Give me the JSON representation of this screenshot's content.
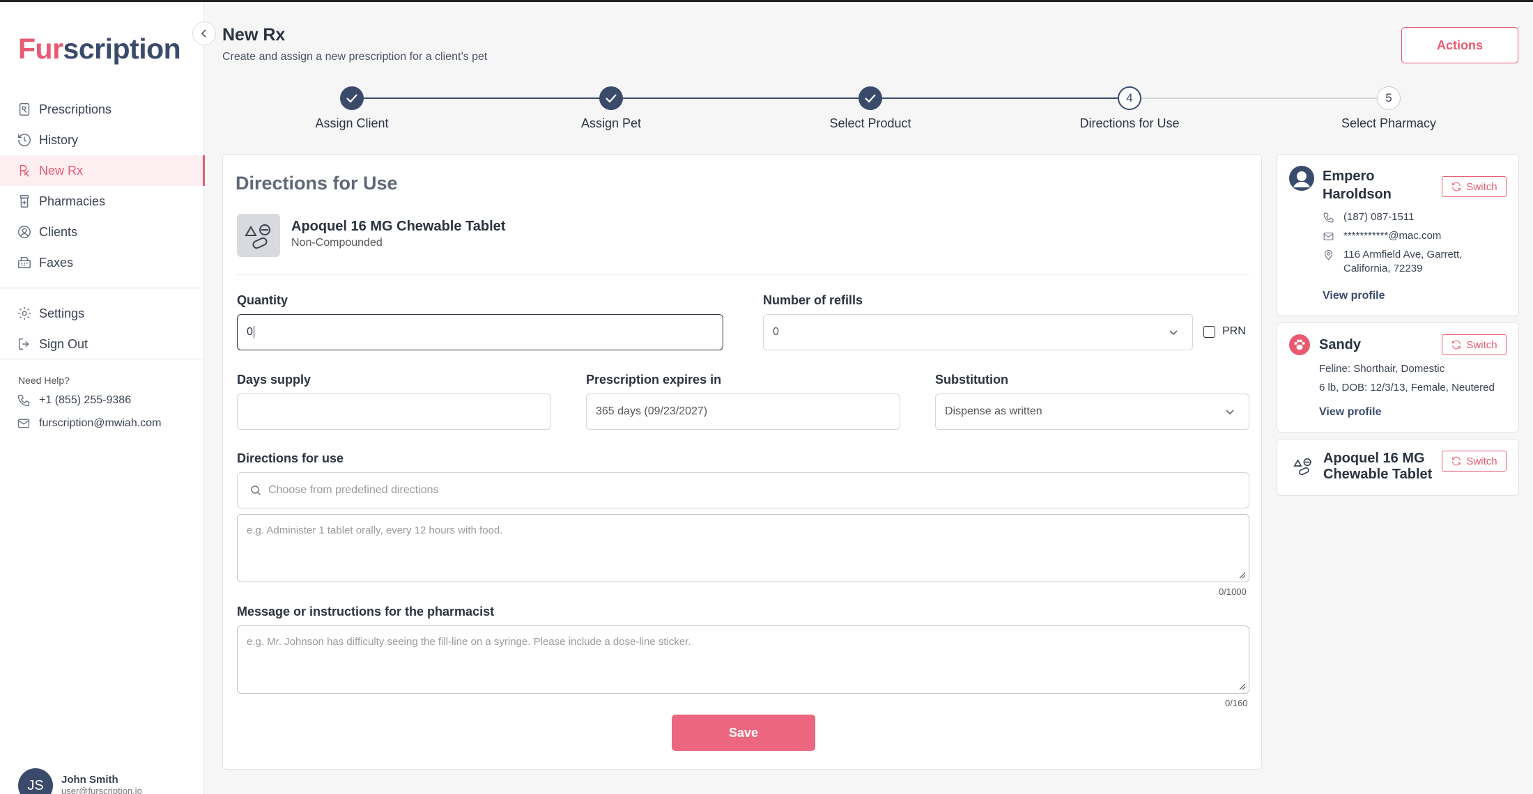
{
  "brand": {
    "part1": "Fur",
    "part2": "scription"
  },
  "sidebar": {
    "items": [
      {
        "label": "Prescriptions",
        "icon": "prescription-icon"
      },
      {
        "label": "History",
        "icon": "history-icon"
      },
      {
        "label": "New Rx",
        "icon": "rx-icon"
      },
      {
        "label": "Pharmacies",
        "icon": "pharmacy-icon"
      },
      {
        "label": "Clients",
        "icon": "client-icon"
      },
      {
        "label": "Faxes",
        "icon": "fax-icon"
      }
    ],
    "settings": "Settings",
    "signout": "Sign Out",
    "help_title": "Need Help?",
    "phone": "+1 (855) 255-9386",
    "email": "furscription@mwiah.com",
    "user": {
      "initials": "JS",
      "name": "John Smith",
      "email": "user@furscription.io"
    }
  },
  "header": {
    "title": "New Rx",
    "subtitle": "Create and assign a new prescription for a client’s pet",
    "actions_label": "Actions"
  },
  "stepper": {
    "steps": [
      {
        "label": "Assign Client",
        "state": "done"
      },
      {
        "label": "Assign Pet",
        "state": "done"
      },
      {
        "label": "Select Product",
        "state": "done"
      },
      {
        "label": "Directions for Use",
        "state": "current",
        "number": "4"
      },
      {
        "label": "Select Pharmacy",
        "state": "todo",
        "number": "5"
      }
    ]
  },
  "form": {
    "title": "Directions for Use",
    "product_name": "Apoquel 16 MG Chewable Tablet",
    "product_type": "Non-Compounded",
    "quantity_label": "Quantity",
    "quantity_value": "0",
    "refills_label": "Number of refills",
    "refills_value": "0",
    "prn_label": "PRN",
    "days_label": "Days supply",
    "days_value": "",
    "expires_label": "Prescription expires in",
    "expires_value": "365 days (09/23/2027)",
    "substitution_label": "Substitution",
    "substitution_value": "Dispense as written",
    "directions_label": "Directions for use",
    "directions_search_placeholder": "Choose from predefined directions",
    "directions_placeholder": "e.g. Administer 1 tablet orally, every 12 hours with food.",
    "directions_counter": "0/1000",
    "message_label": "Message or instructions for the pharmacist",
    "message_placeholder": "e.g. Mr. Johnson has difficulty seeing the fill-line on a syringe. Please include a dose-line sticker.",
    "message_counter": "0/160",
    "save_label": "Save"
  },
  "client_card": {
    "name": "Empero Haroldson",
    "phone": "(187) 087-1511",
    "email": "***********@mac.com",
    "address": "116 Armfield Ave, Garrett, California, 72239",
    "link": "View profile",
    "switch": "Switch"
  },
  "pet_card": {
    "name": "Sandy",
    "line1": "Feline: Shorthair, Domestic",
    "line2": "6 lb, DOB: 12/3/13, Female, Neutered",
    "link": "View profile",
    "switch": "Switch"
  },
  "product_card": {
    "name": "Apoquel 16 MG Chewable Tablet",
    "switch": "Switch"
  },
  "colors": {
    "accent": "#e85a72",
    "navy": "#3a4a6b",
    "save": "#ec6680"
  }
}
